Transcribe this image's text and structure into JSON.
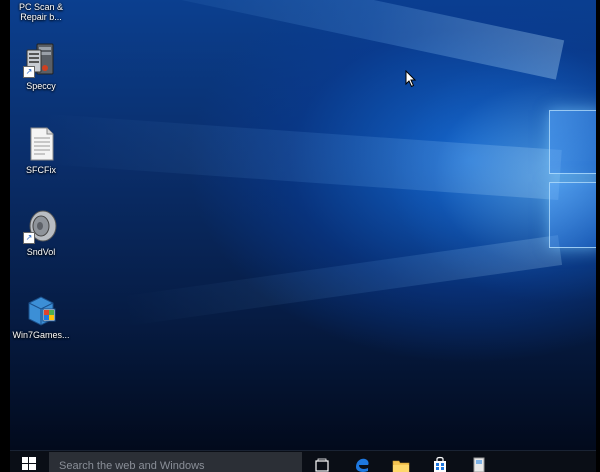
{
  "desktop": {
    "icons": [
      {
        "label": "PC Scan &\nRepair b...",
        "icon": "pc-scan-repair-icon"
      },
      {
        "label": "Speccy",
        "icon": "speccy-icon"
      },
      {
        "label": "SFCFix",
        "icon": "document-icon"
      },
      {
        "label": "SndVol",
        "icon": "speaker-icon"
      },
      {
        "label": "Win7Games...",
        "icon": "games-installer-icon"
      }
    ]
  },
  "taskbar": {
    "search_placeholder": "Search the web and Windows",
    "items": [
      "task-view-icon",
      "edge-browser-icon",
      "file-explorer-icon",
      "store-icon",
      "app-icon"
    ]
  },
  "colors": {
    "accent": "#1e78e0",
    "taskbar": "#0a0e16"
  }
}
